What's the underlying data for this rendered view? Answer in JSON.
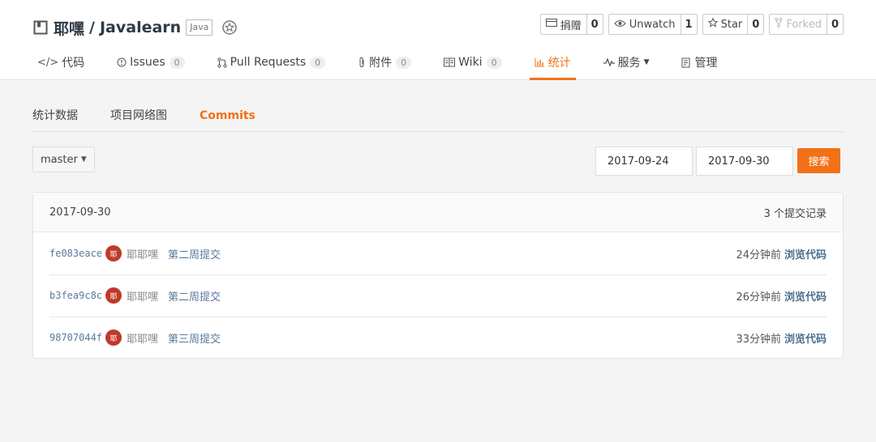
{
  "repo": {
    "owner": "耶嘿",
    "separator": "/",
    "name": "Javalearn",
    "language": "Java"
  },
  "actions": [
    {
      "label": "捐赠",
      "count": "0",
      "icon": "donate-icon"
    },
    {
      "label": "Unwatch",
      "count": "1",
      "icon": "eye-icon"
    },
    {
      "label": "Star",
      "count": "0",
      "icon": "star-icon"
    },
    {
      "label": "Forked",
      "count": "0",
      "icon": "fork-icon"
    }
  ],
  "tabs": [
    {
      "label": "代码",
      "icon": "code-icon"
    },
    {
      "label": "Issues",
      "count": "0",
      "icon": "issue-icon"
    },
    {
      "label": "Pull Requests",
      "count": "0",
      "icon": "pull-request-icon"
    },
    {
      "label": "附件",
      "count": "0",
      "icon": "attachment-icon"
    },
    {
      "label": "Wiki",
      "count": "0",
      "icon": "wiki-icon"
    },
    {
      "label": "统计",
      "icon": "chart-icon"
    },
    {
      "label": "服务",
      "icon": "pulse-icon"
    },
    {
      "label": "管理",
      "icon": "manage-icon"
    }
  ],
  "subnav": [
    "统计数据",
    "项目网络图",
    "Commits"
  ],
  "branch": "master",
  "filter": {
    "start_date": "2017-09-24",
    "end_date": "2017-09-30",
    "search_label": "搜索"
  },
  "commits": {
    "date": "2017-09-30",
    "summary": "3 个提交记录",
    "rows": [
      {
        "sha": "fe083eace",
        "avatar": "耶",
        "author": "耶耶嘿",
        "message": "第二周提交",
        "time": "24分钟前",
        "browse": "浏览代码"
      },
      {
        "sha": "b3fea9c8c",
        "avatar": "耶",
        "author": "耶耶嘿",
        "message": "第二周提交",
        "time": "26分钟前",
        "browse": "浏览代码"
      },
      {
        "sha": "98707044f",
        "avatar": "耶",
        "author": "耶耶嘿",
        "message": "第三周提交",
        "time": "33分钟前",
        "browse": "浏览代码"
      }
    ]
  },
  "colors": {
    "accent": "#f27117",
    "link": "#4a6f8f",
    "avatar": "#c0392b"
  }
}
